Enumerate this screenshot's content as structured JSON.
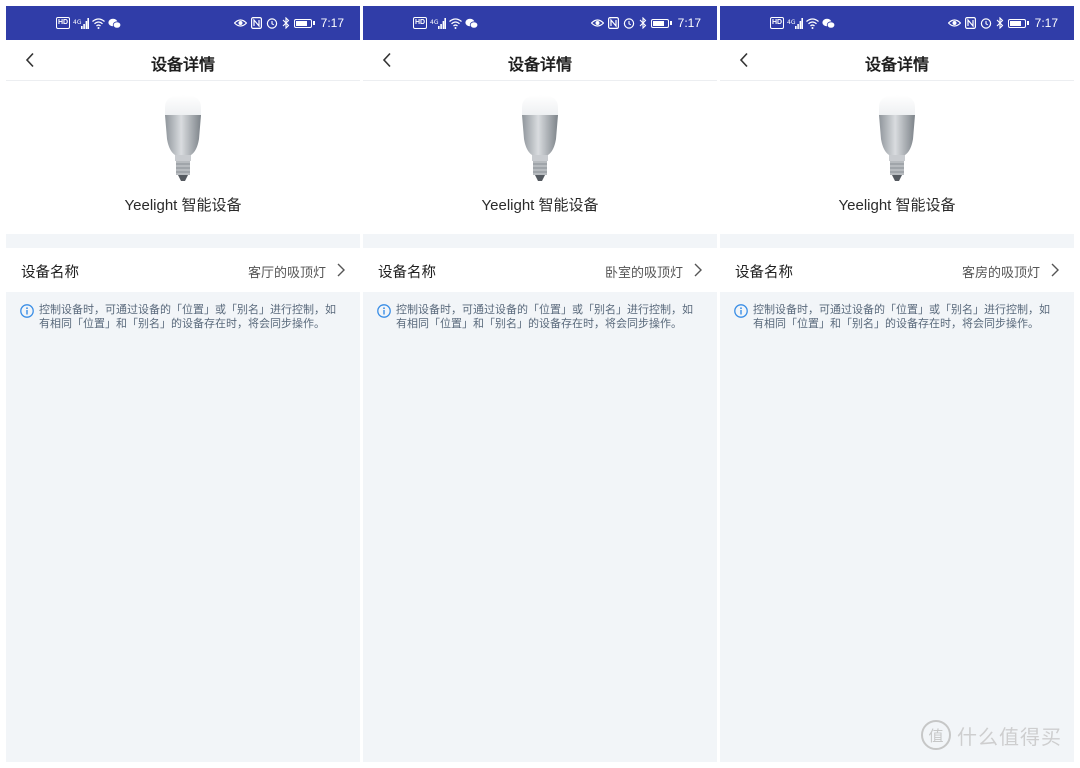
{
  "colors": {
    "status_bar": "#303da8",
    "page_background": "#f2f5f8",
    "card_background": "#ffffff",
    "info_accent": "#3a8ee6"
  },
  "status_bar": {
    "time": "7:17",
    "left_icons": [
      "hd-icon",
      "signal-icon",
      "wifi-icon",
      "wechat-icon"
    ],
    "right_icons": [
      "eye-comfort-icon",
      "nfc-icon",
      "alarm-icon",
      "bluetooth-icon",
      "battery-icon"
    ],
    "hd_label": "HD"
  },
  "screens": [
    {
      "title": "设备详情",
      "device_type": "Yeelight 智能设备",
      "name_label": "设备名称",
      "name_value": "客厅的吸顶灯",
      "info_text": "控制设备时，可通过设备的「位置」或「别名」进行控制，如有相同「位置」和「别名」的设备存在时，将会同步操作。"
    },
    {
      "title": "设备详情",
      "device_type": "Yeelight 智能设备",
      "name_label": "设备名称",
      "name_value": "卧室的吸顶灯",
      "info_text": "控制设备时，可通过设备的「位置」或「别名」进行控制，如有相同「位置」和「别名」的设备存在时，将会同步操作。"
    },
    {
      "title": "设备详情",
      "device_type": "Yeelight 智能设备",
      "name_label": "设备名称",
      "name_value": "客房的吸顶灯",
      "info_text": "控制设备时，可通过设备的「位置」或「别名」进行控制，如有相同「位置」和「别名」的设备存在时，将会同步操作。"
    }
  ],
  "watermark": {
    "logo_char": "值",
    "text": "什么值得买"
  }
}
